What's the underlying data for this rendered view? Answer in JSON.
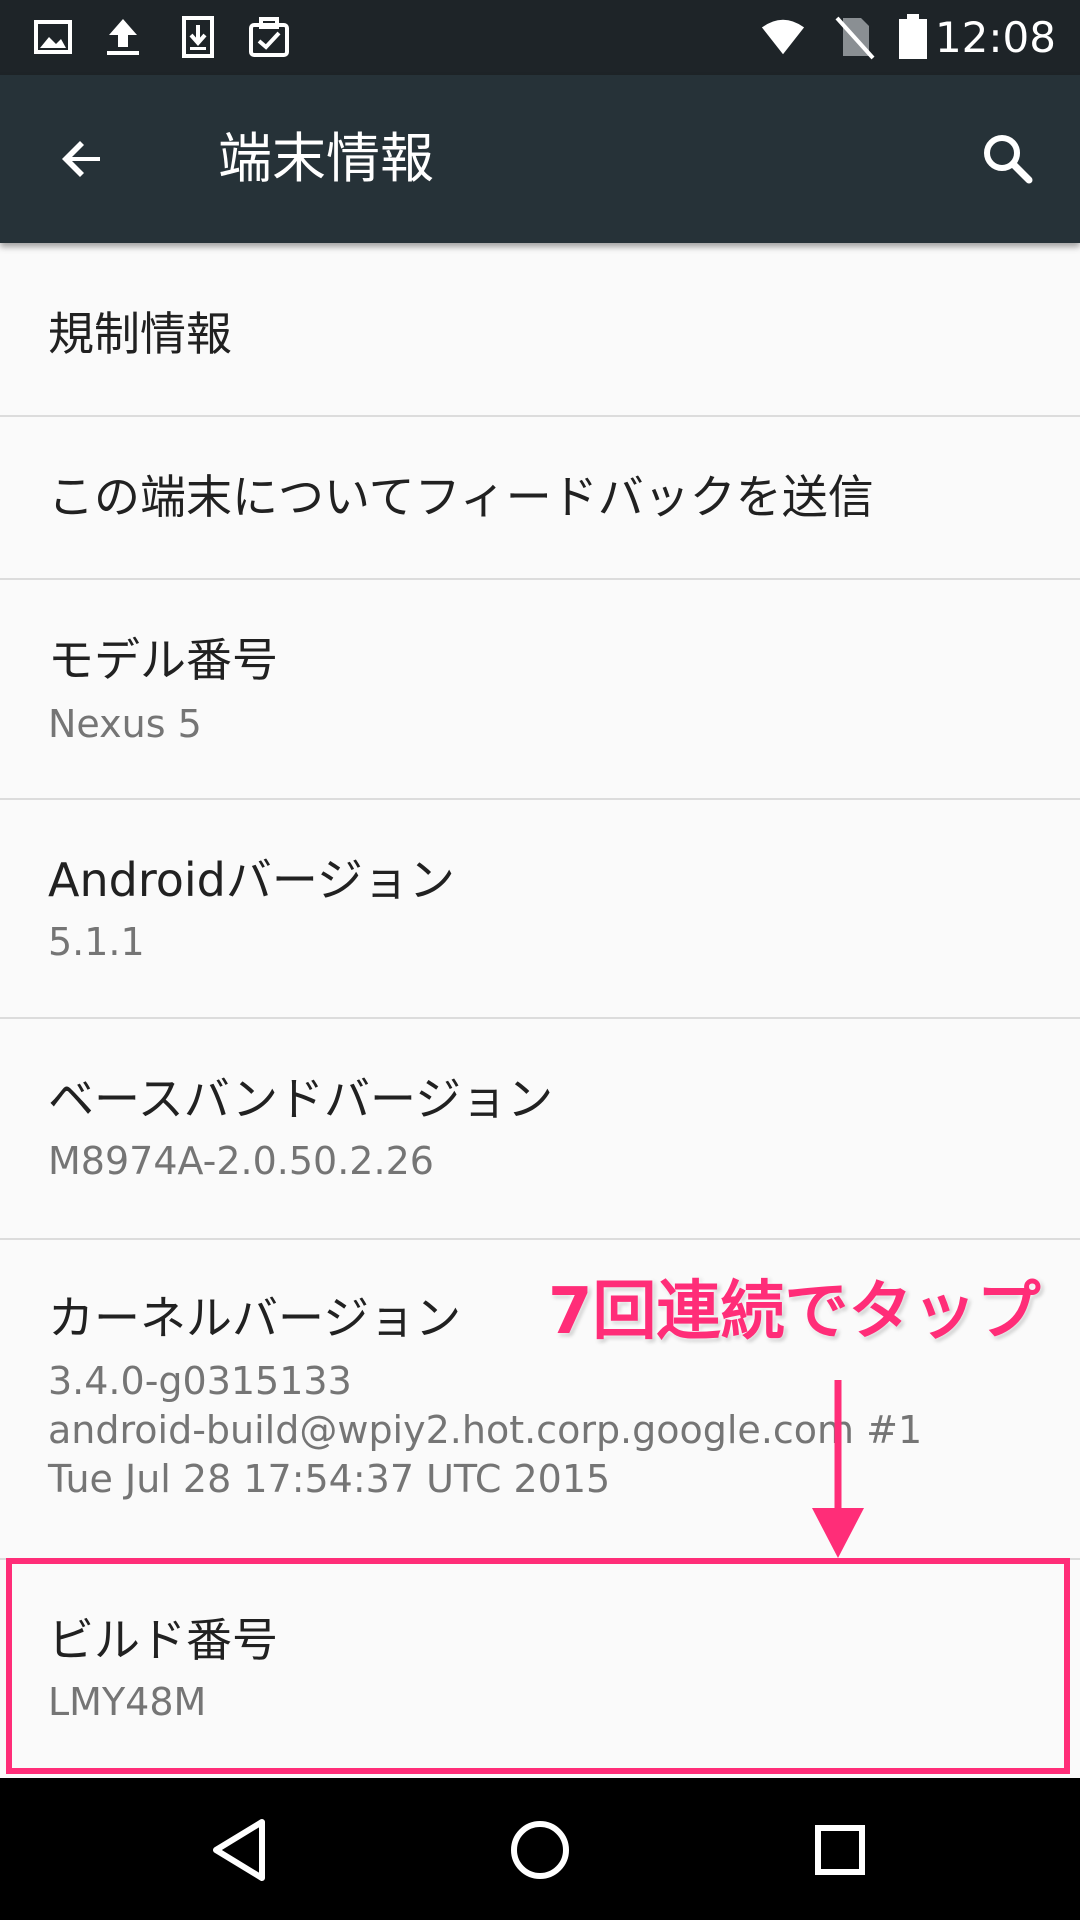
{
  "status_bar": {
    "time": "12:08",
    "left_icons": [
      "image-icon",
      "upload-icon",
      "download-icon",
      "clipboard-check-icon"
    ],
    "right_icons": [
      "wifi-icon",
      "no-sim-icon",
      "battery-icon"
    ]
  },
  "app_bar": {
    "title": "端末情報",
    "back_icon": "arrow-left-icon",
    "search_icon": "search-icon"
  },
  "items": [
    {
      "title": "規制情報"
    },
    {
      "title": "この端末についてフィードバックを送信"
    },
    {
      "title": "モデル番号",
      "summary": "Nexus 5"
    },
    {
      "title": "Androidバージョン",
      "summary": "5.1.1"
    },
    {
      "title": "ベースバンドバージョン",
      "summary": "M8974A-2.0.50.2.26"
    },
    {
      "title": "カーネルバージョン",
      "summary_lines": [
        "3.4.0-g0315133",
        "android-build@wpiy2.hot.corp.google.com #1",
        "Tue Jul 28 17:54:37 UTC 2015"
      ]
    },
    {
      "title": "ビルド番号",
      "summary": "LMY48M"
    }
  ],
  "annotation": {
    "text": "7回連続でタップ",
    "color": "#ff2d78"
  },
  "nav_bar": {
    "icons": [
      "back-triangle-icon",
      "home-circle-icon",
      "recents-square-icon"
    ]
  }
}
